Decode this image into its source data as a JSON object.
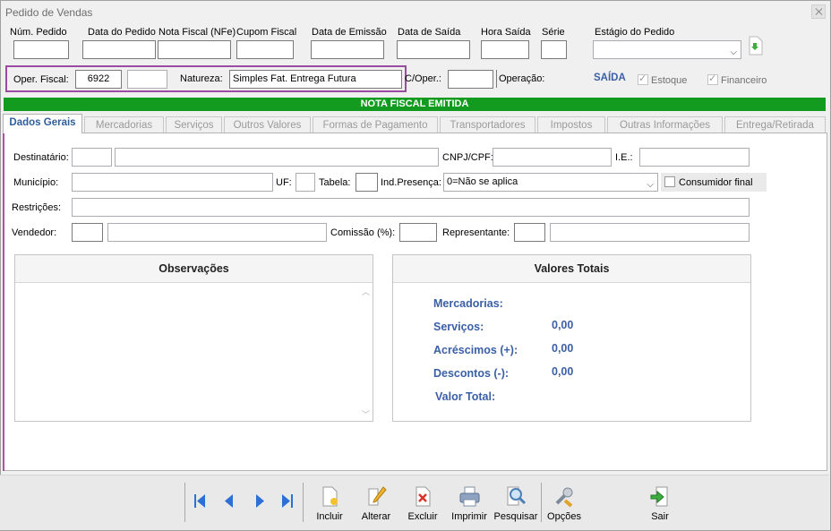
{
  "window": {
    "title": "Pedido de Vendas"
  },
  "header_fields": {
    "num_pedido": "Núm. Pedido",
    "data_pedido": "Data do Pedido",
    "nota_fiscal": "Nota Fiscal (NFe)",
    "cupom_fiscal": "Cupom Fiscal",
    "data_emissao": "Data de Emissão",
    "data_saida": "Data de Saída",
    "hora_saida": "Hora Saída",
    "serie": "Série",
    "estagio": "Estágio do Pedido"
  },
  "oper": {
    "oper_fiscal_label": "Oper. Fiscal:",
    "oper_fiscal_value": "6922",
    "natureza_label": "Natureza:",
    "natureza_value": "Simples Fat. Entrega Futura",
    "c_oper_label": "C/Oper.:",
    "operacao_label": "Operação:",
    "saida": "SAÍDA",
    "estoque": "Estoque",
    "financeiro": "Financeiro"
  },
  "nf_banner": "NOTA FISCAL EMITIDA",
  "tabs": [
    {
      "label": "Dados Gerais",
      "active": true
    },
    {
      "label": "Mercadorias"
    },
    {
      "label": "Serviços"
    },
    {
      "label": "Outros Valores"
    },
    {
      "label": "Formas de Pagamento"
    },
    {
      "label": "Transportadores"
    },
    {
      "label": "Impostos"
    },
    {
      "label": "Outras Informações"
    },
    {
      "label": "Entrega/Retirada"
    }
  ],
  "form": {
    "destinatario": "Destinatário:",
    "cnpj": "CNPJ/CPF:",
    "ie": "I.E.:",
    "municipio": "Município:",
    "uf": "UF:",
    "tabela": "Tabela:",
    "ind_presenca": "Ind.Presença:",
    "ind_presenca_value": "0=Não se aplica",
    "consumidor_final": "Consumidor final",
    "restricoes": "Restrições:",
    "vendedor": "Vendedor:",
    "comissao": "Comissão (%):",
    "representante": "Representante:"
  },
  "observacoes": {
    "title": "Observações"
  },
  "valores": {
    "title": "Valores Totais",
    "mercadorias": "Mercadorias:",
    "servicos": "Serviços:",
    "servicos_value": "0,00",
    "acrescimos": "Acréscimos (+):",
    "acrescimos_value": "0,00",
    "descontos": "Descontos (-):",
    "descontos_value": "0,00",
    "valor_total": "Valor Total:"
  },
  "toolbar": {
    "incluir": "Incluir",
    "alterar": "Alterar",
    "excluir": "Excluir",
    "imprimir": "Imprimir",
    "pesquisar": "Pesquisar",
    "opcoes": "Opções",
    "sair": "Sair"
  },
  "colors": {
    "accent": "#3a5fa6",
    "nf_green": "#139b1f",
    "highlight": "#9b4ca0"
  }
}
